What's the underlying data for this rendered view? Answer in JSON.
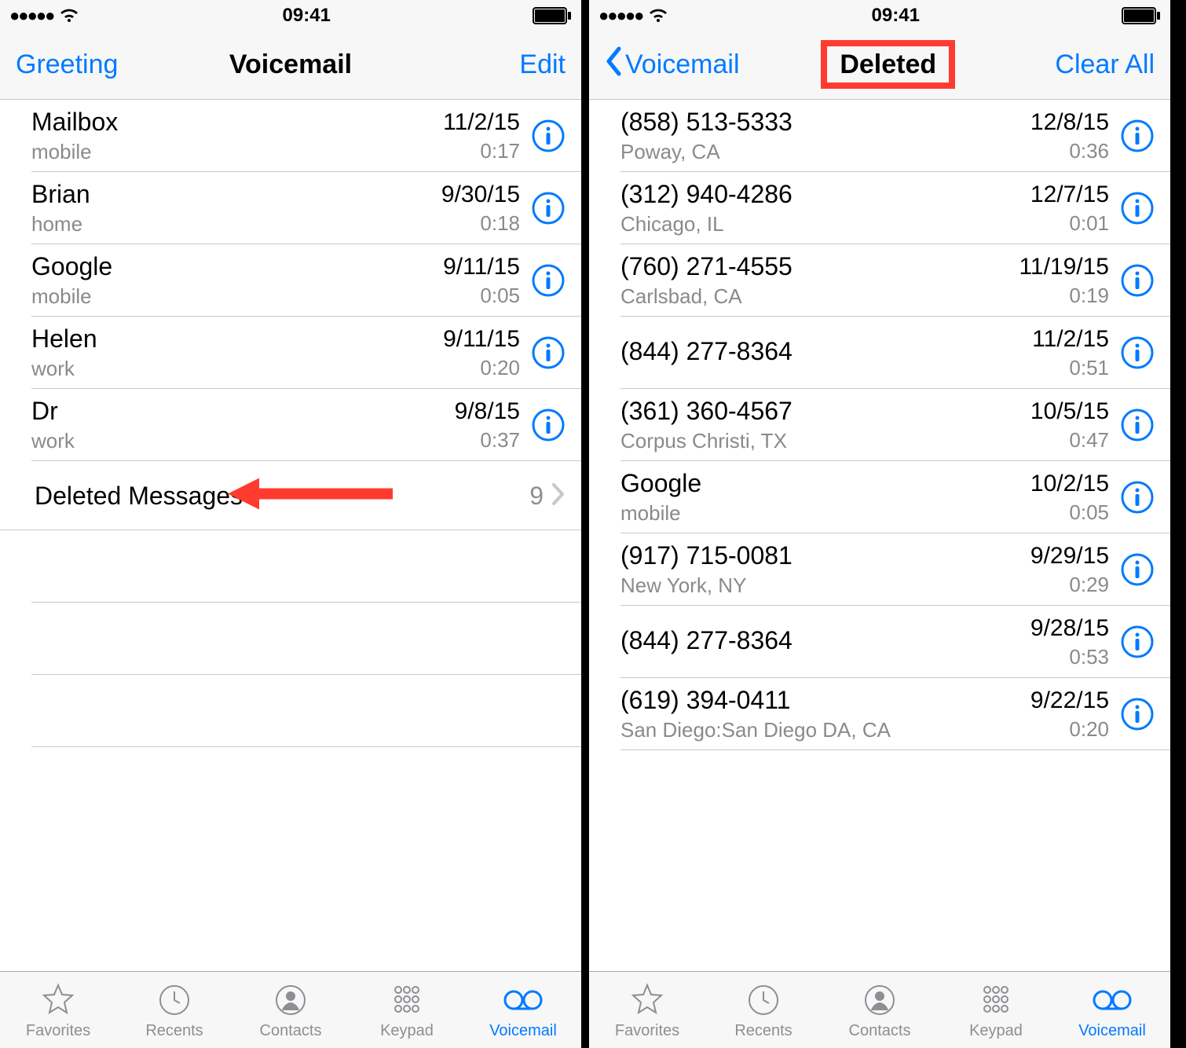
{
  "status": {
    "time": "09:41"
  },
  "left": {
    "nav": {
      "left": "Greeting",
      "title": "Voicemail",
      "right": "Edit"
    },
    "rows": [
      {
        "name": "Mailbox",
        "sub": "mobile",
        "date": "11/2/15",
        "dur": "0:17"
      },
      {
        "name": "Brian",
        "sub": "home",
        "date": "9/30/15",
        "dur": "0:18"
      },
      {
        "name": "Google",
        "sub": "mobile",
        "date": "9/11/15",
        "dur": "0:05"
      },
      {
        "name": "Helen",
        "sub": "work",
        "date": "9/11/15",
        "dur": "0:20"
      },
      {
        "name": "Dr",
        "sub": "work",
        "date": "9/8/15",
        "dur": "0:37"
      }
    ],
    "deleted": {
      "label": "Deleted Messages",
      "count": "9"
    }
  },
  "right": {
    "nav": {
      "back": "Voicemail",
      "title": "Deleted",
      "right": "Clear All"
    },
    "rows": [
      {
        "name": "(858) 513-5333",
        "sub": "Poway, CA",
        "date": "12/8/15",
        "dur": "0:36"
      },
      {
        "name": "(312) 940-4286",
        "sub": "Chicago, IL",
        "date": "12/7/15",
        "dur": "0:01"
      },
      {
        "name": "(760) 271-4555",
        "sub": "Carlsbad, CA",
        "date": "11/19/15",
        "dur": "0:19"
      },
      {
        "name": "(844) 277-8364",
        "sub": "",
        "date": "11/2/15",
        "dur": "0:51"
      },
      {
        "name": "(361) 360-4567",
        "sub": "Corpus Christi, TX",
        "date": "10/5/15",
        "dur": "0:47"
      },
      {
        "name": "Google",
        "sub": "mobile",
        "date": "10/2/15",
        "dur": "0:05"
      },
      {
        "name": "(917) 715-0081",
        "sub": "New York, NY",
        "date": "9/29/15",
        "dur": "0:29"
      },
      {
        "name": "(844) 277-8364",
        "sub": "",
        "date": "9/28/15",
        "dur": "0:53"
      },
      {
        "name": "(619) 394-0411",
        "sub": "San Diego:San Diego DA, CA",
        "date": "9/22/15",
        "dur": "0:20"
      }
    ]
  },
  "tabs": {
    "favorites": "Favorites",
    "recents": "Recents",
    "contacts": "Contacts",
    "keypad": "Keypad",
    "voicemail": "Voicemail"
  }
}
